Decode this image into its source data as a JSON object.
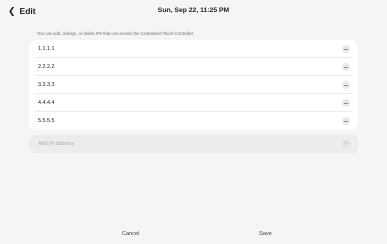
{
  "header": {
    "back_icon": "chevron-left-icon",
    "back_label": "Edit",
    "clock": "Sun, Sep 22, 11:25 PM"
  },
  "description": "You can add, change, or delete IPs that can access the Centralized Touch Controller.",
  "ip_list": [
    {
      "address": "1.1.1.1",
      "action_icon": "minus-icon"
    },
    {
      "address": "2.2.2.2",
      "action_icon": "minus-icon"
    },
    {
      "address": "3.3.3.3",
      "action_icon": "minus-icon"
    },
    {
      "address": "4.4.4.4",
      "action_icon": "minus-icon"
    },
    {
      "address": "5.5.5.5",
      "action_icon": "minus-icon"
    }
  ],
  "add_field": {
    "placeholder": "Add IP address",
    "action_icon": "plus-icon"
  },
  "footer": {
    "cancel_label": "Cancel",
    "save_label": "Save"
  }
}
